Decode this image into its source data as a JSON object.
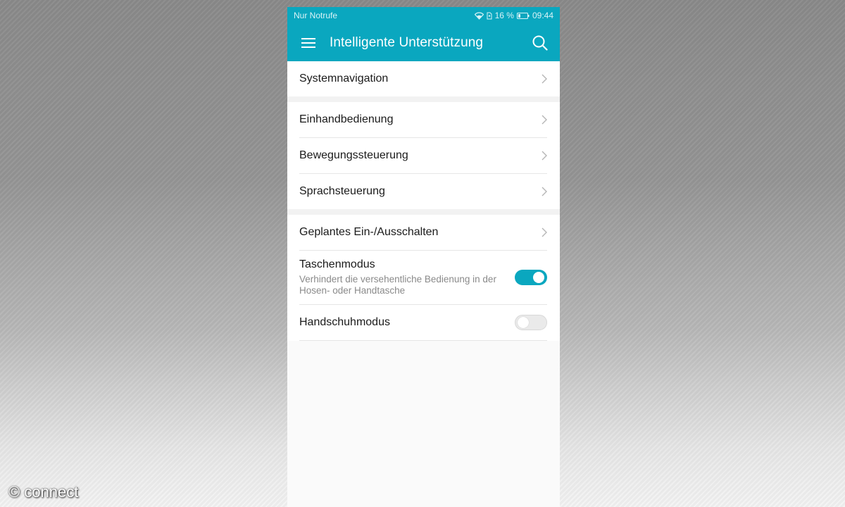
{
  "status_bar": {
    "carrier": "Nur Notrufe",
    "battery_percent": "16 %",
    "time": "09:44",
    "icons": [
      "wifi-icon",
      "sim-icon",
      "battery-icon"
    ]
  },
  "app_bar": {
    "title": "Intelligente Unterstützung",
    "menu_icon": "hamburger-menu-icon",
    "search_icon": "search-icon"
  },
  "groups": [
    {
      "items": [
        {
          "label": "Systemnavigation",
          "type": "link"
        }
      ]
    },
    {
      "items": [
        {
          "label": "Einhandbedienung",
          "type": "link"
        },
        {
          "label": "Bewegungssteuerung",
          "type": "link"
        },
        {
          "label": "Sprachsteuerung",
          "type": "link"
        }
      ]
    },
    {
      "items": [
        {
          "label": "Geplantes Ein-/Ausschalten",
          "type": "link"
        },
        {
          "label": "Taschenmodus",
          "subtitle": "Verhindert die versehentliche Bedienung in der Hosen- oder Handtasche",
          "type": "toggle",
          "enabled": true
        },
        {
          "label": "Handschuhmodus",
          "type": "toggle",
          "enabled": false
        }
      ]
    }
  ],
  "watermark": "© connect",
  "colors": {
    "accent": "#0aa7bf",
    "toggle_off": "#eaeaea"
  }
}
